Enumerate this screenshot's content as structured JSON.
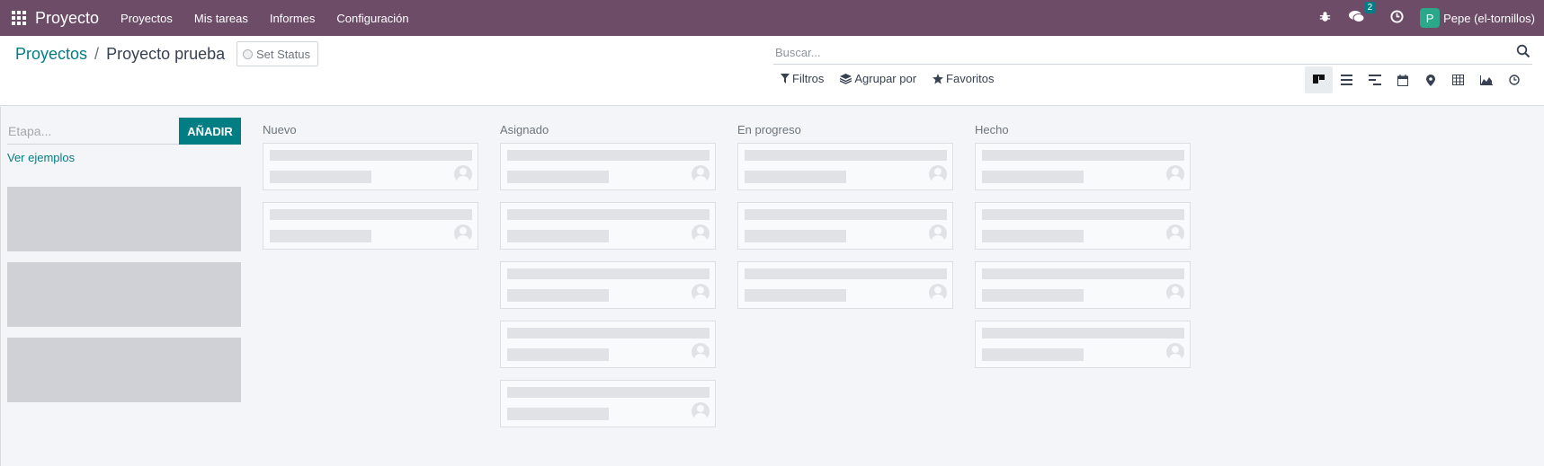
{
  "app": {
    "name": "Proyecto",
    "menu": [
      "Proyectos",
      "Mis tareas",
      "Informes",
      "Configuración"
    ]
  },
  "systray": {
    "messages_count": "2",
    "user_initial": "P",
    "user_name": "Pepe (el-tornillos)"
  },
  "breadcrumb": {
    "parent": "Proyectos",
    "separator": "/",
    "current": "Proyecto prueba"
  },
  "status_button": "Set Status",
  "search": {
    "placeholder": "Buscar..."
  },
  "filters": {
    "filters": "Filtros",
    "group_by": "Agrupar por",
    "favorites": "Favoritos"
  },
  "views": [
    "kanban-icon",
    "list-icon",
    "gantt-icon",
    "calendar-icon",
    "map-icon",
    "pivot-icon",
    "graph-icon",
    "activity-icon"
  ],
  "quick_create": {
    "placeholder": "Etapa...",
    "add_label": "AÑADIR",
    "examples_link": "Ver ejemplos"
  },
  "columns": [
    {
      "title": "Nuevo",
      "cards": 2
    },
    {
      "title": "Asignado",
      "cards": 5
    },
    {
      "title": "En progreso",
      "cards": 3
    },
    {
      "title": "Hecho",
      "cards": 4
    }
  ],
  "colors": {
    "navbar": "#6d4c68",
    "accent": "#017e84"
  }
}
